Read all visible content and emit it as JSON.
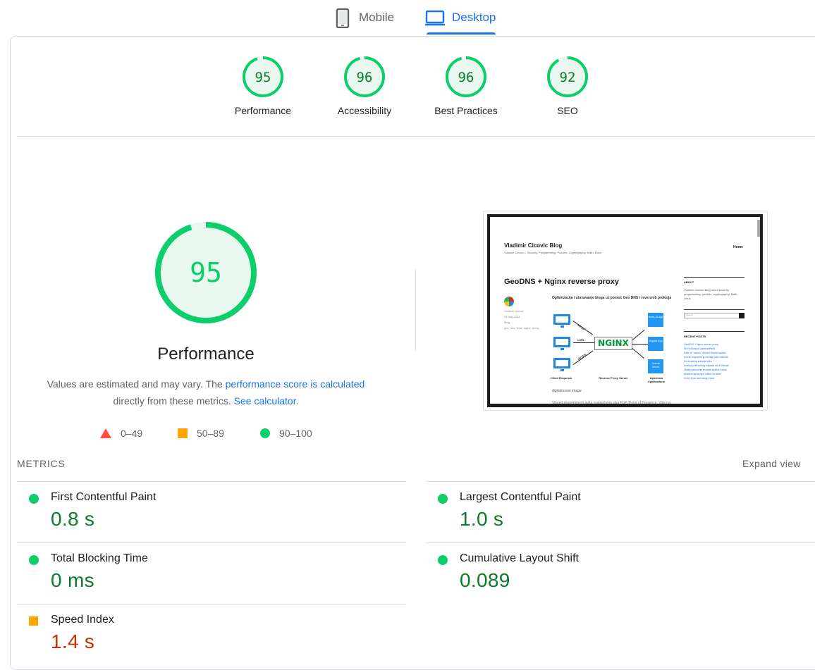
{
  "tabs": {
    "mobile": {
      "label": "Mobile",
      "icon": "phone-icon"
    },
    "desktop": {
      "label": "Desktop",
      "icon": "laptop-icon",
      "selected": true
    }
  },
  "categories": [
    {
      "score": "95",
      "label": "Performance",
      "fraction": 0.95
    },
    {
      "score": "96",
      "label": "Accessibility",
      "fraction": 0.96
    },
    {
      "score": "96",
      "label": "Best Practices",
      "fraction": 0.96
    },
    {
      "score": "92",
      "label": "SEO",
      "fraction": 0.92
    }
  ],
  "performance": {
    "score": "95",
    "fraction": 0.95,
    "title": "Performance",
    "desc_prefix": "Values are estimated and may vary. The ",
    "desc_link": "performance score is calculated",
    "desc_middle": "directly from these metrics. ",
    "desc_link2": "See calculator.",
    "legend": {
      "fail": "0–49",
      "average": "50–89",
      "pass": "90–100"
    }
  },
  "screenshot": {
    "blog_title": "Vladimir Cicovic Blog",
    "blog_tagline": "Vladimir Cicovic – Security, Programming, Puzzles, Cryptography, Math, Linux",
    "nav_home": "Home",
    "post_title": "GeoDNS + Nginx reverse proxy",
    "post_meta": [
      "Vladimir cicovic",
      "23 Aug 2024",
      "Blog",
      "geo, dns, linux, nginx, proxy"
    ],
    "post_subtitle": "Optimizacija i ubrzavanje bloga uz pomoć Geo DNS i reverznih proksija",
    "diagram": {
      "nginx": "NGINX",
      "clients": "Client Requests",
      "proxy": "Reverse Proxy Server",
      "upstream": "Upstream Applications",
      "http": "HTTP",
      "curl": "cURL",
      "https": "HTTPS",
      "app1": "Node.JS App",
      "app2": "Angular App",
      "app3": "Tomcat Server"
    },
    "caption": "digitalocean image",
    "body_more": "Vikend ekspertiment iasta svatavčenia sika PoP (Point of Presence: Više na",
    "sidebar": {
      "about_head": "ABOUT",
      "about_text": "Vladimir Cicovic Blog about security, programming, puzzles, cryptography, Math, Linux",
      "search_placeholder": "Search …",
      "recent_head": "RECENT POSTS",
      "recent_posts": [
        "GeoDNS + Nginx reverse proxy",
        "DOOM napad (case/artifact)",
        "Kako je \"ukinuo\" Amonit Klasik izgubio",
        "(social engineering iskušaj) lako odlazak",
        "Kol knowing koncept sliku",
        "Analiza prethodnog napada na ID Sender",
        "Lakša hakovanje prostila zaštiva Sreda",
        "Analiza najvažnijih online što kaže",
        "How to use and setup tricks"
      ]
    }
  },
  "metrics": {
    "header": "METRICS",
    "expand": "Expand view",
    "items": [
      {
        "name": "First Contentful Paint",
        "value": "0.8 s",
        "status": "pass"
      },
      {
        "name": "Largest Contentful Paint",
        "value": "1.0 s",
        "status": "pass"
      },
      {
        "name": "Total Blocking Time",
        "value": "0 ms",
        "status": "pass"
      },
      {
        "name": "Cumulative Layout Shift",
        "value": "0.089",
        "status": "pass"
      },
      {
        "name": "Speed Index",
        "value": "1.4 s",
        "status": "average"
      }
    ]
  },
  "colors": {
    "pass": "#0cce6b",
    "pass_text": "#0d7a2c",
    "average": "#ffa400",
    "fail": "#ff4e42",
    "link": "#1a73e8"
  }
}
